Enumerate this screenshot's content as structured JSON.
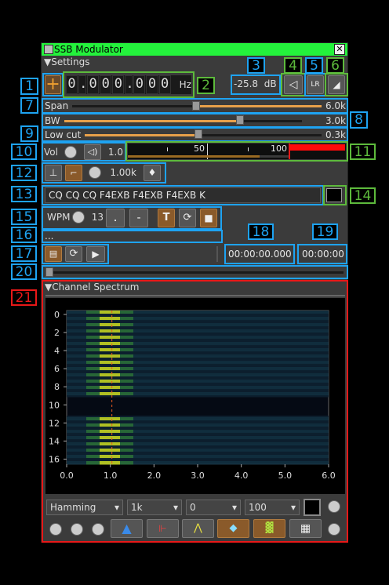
{
  "window": {
    "title": "SSB Modulator",
    "close_glyph": "✕"
  },
  "sections": {
    "settings": "Settings",
    "channel_spectrum": "Channel Spectrum"
  },
  "callouts": [
    "1",
    "2",
    "3",
    "4",
    "5",
    "6",
    "7",
    "8",
    "9",
    "10",
    "11",
    "12",
    "13",
    "14",
    "15",
    "16",
    "17",
    "18",
    "19",
    "20",
    "21"
  ],
  "freq": {
    "digits": [
      "0",
      ".",
      "0",
      "0",
      "0",
      ".",
      "0",
      "0",
      "0"
    ],
    "unit": "Hz",
    "plus": "+"
  },
  "gain": {
    "value": "-25.8",
    "unit": "dB"
  },
  "buttons": {
    "lr": "LR",
    "play": "▶",
    "stop": "■",
    "loop": "⟳",
    "tbtn": "T",
    "dot": ".",
    "dash": "-"
  },
  "span": {
    "label": "Span",
    "value": "6.0k",
    "level": 0.42
  },
  "bw": {
    "label": "BW",
    "value": "3.0k",
    "level": 0.74
  },
  "lowcut": {
    "label": "Low cut",
    "value": "0.3k",
    "level": 0.5
  },
  "vol": {
    "label": "Vol",
    "value": "1.0",
    "meter_ticks": [
      "50",
      "100"
    ]
  },
  "tone": {
    "value": "1.00k"
  },
  "morse": {
    "text": "CQ CQ CQ F4EXB F4EXB F4EXB K"
  },
  "wpm": {
    "label": "WPM",
    "value": "13"
  },
  "file": {
    "name": "...",
    "time_now": "00:00:00.000",
    "time_total": "00:00:00"
  },
  "spectrum": {
    "y_ticks": [
      "0",
      "2",
      "4",
      "6",
      "8",
      "10",
      "12",
      "14",
      "16"
    ],
    "x_ticks": [
      "0.0",
      "1.0",
      "2.0",
      "3.0",
      "4.0",
      "5.0",
      "6.0"
    ],
    "combos": [
      "Hamming",
      "1k",
      "0",
      "100"
    ]
  }
}
